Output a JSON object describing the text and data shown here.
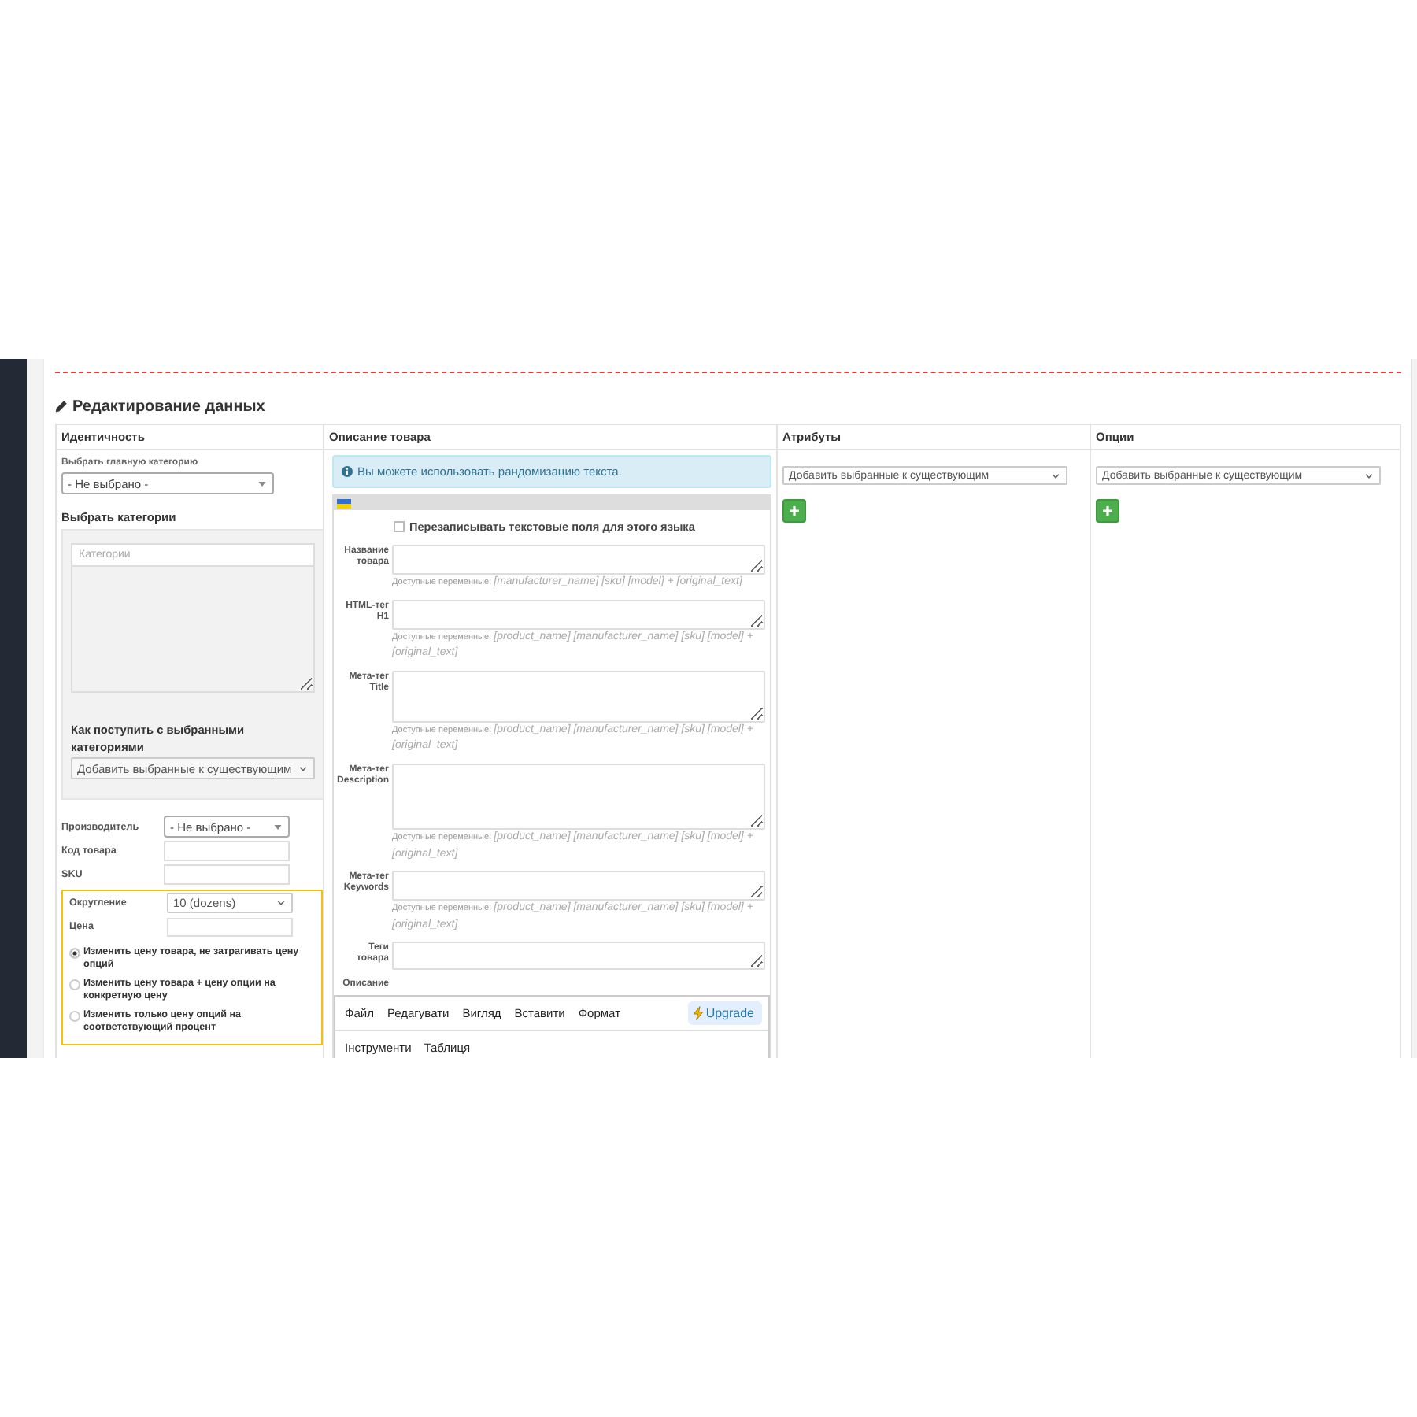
{
  "header": {
    "title": "Редактирование данных"
  },
  "columns": [
    "Идентичность",
    "Описание товара",
    "Атрибуты",
    "Опции"
  ],
  "identity": {
    "main_category": {
      "label": "Выбрать главную категорию",
      "kind": "searchable_select",
      "value": "- Не выбрано -"
    },
    "categories": {
      "label": "Выбрать категории",
      "placeholder": "Категории",
      "action_label": "Как поступить с выбранными категориями",
      "action_value": "Добавить выбранные к существующим"
    },
    "fields": [
      {
        "kind": "searchable_select",
        "label": "Производитель",
        "value": "- Не выбрано -"
      },
      {
        "kind": "input",
        "label": "Код товара"
      },
      {
        "kind": "input",
        "label": "SKU"
      }
    ],
    "rounding": {
      "fields": [
        {
          "kind": "select",
          "label": "Округление",
          "value": "10 (dozens)"
        },
        {
          "kind": "input",
          "label": "Цена"
        }
      ],
      "options": [
        {
          "label": "Изменить цену товара, не затрагивать цену опций",
          "selected": true
        },
        {
          "label": "Изменить цену товара + цену опции на конкретную цену",
          "selected": false
        },
        {
          "label": "Изменить только цену опций на соответствующий процент",
          "selected": false
        }
      ]
    }
  },
  "description": {
    "notice": "Вы можете использовать рандомизацию текста.",
    "overwrite": {
      "label": "Перезаписывать текстовые поля для этого языка",
      "checked": false
    },
    "fields": [
      {
        "label": "Название товара",
        "hint": "Доступные переменные: *[manufacturer_name] [sku] [model] + [original_text]*"
      },
      {
        "label": "HTML-тег H1",
        "hint": "Доступные переменные: *[product_name] [manufacturer_name] [sku] [model] + [original_text]*"
      },
      {
        "label": "Мета-тег Title",
        "hint": "Доступные переменные: *[product_name] [manufacturer_name] [sku] [model] + [original_text]*"
      },
      {
        "label": "Мета-тег Description",
        "hint": "Доступные переменные: *[product_name] [manufacturer_name] [sku] [model] + [original_text]*"
      },
      {
        "label": "Мета-тег Keywords",
        "hint": "Доступные переменные: *[product_name] [manufacturer_name] [sku] [model] + [original_text]*"
      },
      {
        "label": "Теги товара"
      }
    ],
    "editor": {
      "label": "Описание",
      "menu": [
        "Файл",
        "Редагувати",
        "Вигляд",
        "Вставити",
        "Формат"
      ],
      "upgrade": "Upgrade",
      "toolbar": [
        "Інструменти",
        "Таблиця"
      ]
    }
  },
  "attributes": {
    "value": "Добавить выбранные к существующим"
  },
  "options": {
    "value": "Добавить выбранные к существующим"
  }
}
